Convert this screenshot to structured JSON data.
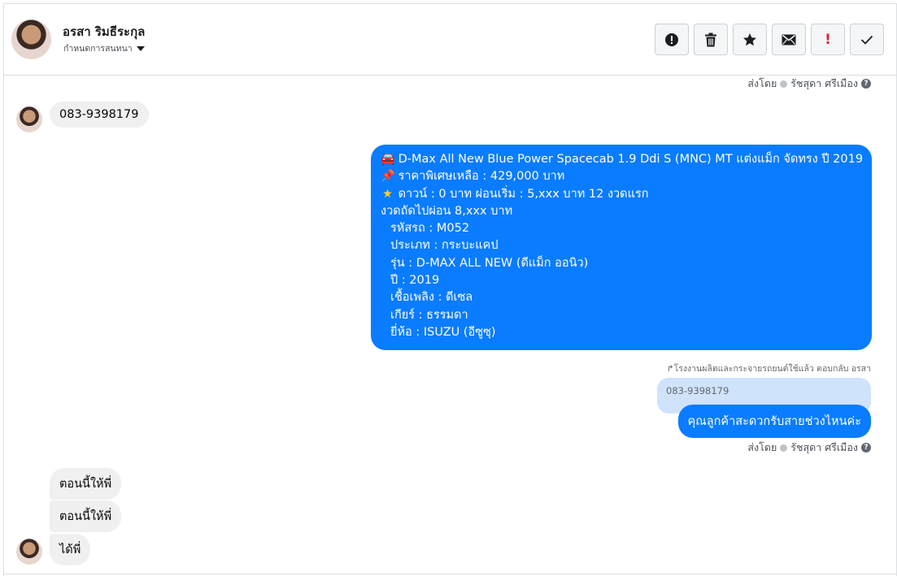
{
  "header": {
    "name": "อรสา ริมธีระกุล",
    "assign_label": "กำหนดการสนทนา",
    "toolbar": [
      {
        "id": "spam",
        "icon": "alert-circle-icon"
      },
      {
        "id": "delete",
        "icon": "trash-icon"
      },
      {
        "id": "star",
        "icon": "star-icon"
      },
      {
        "id": "mark-unread",
        "icon": "envelope-icon"
      },
      {
        "id": "important",
        "icon": "exclamation-icon",
        "label": "!"
      },
      {
        "id": "done",
        "icon": "check-icon"
      }
    ]
  },
  "sent_by_top": {
    "prefix": "ส่งโดย",
    "agent": "รัชสุดา ศรีเมือง",
    "help": "?"
  },
  "messages": {
    "in_phone": "083-9398179",
    "out_card": {
      "line1": "D-Max All New Blue Power Spacecab 1.9 Ddi S (MNC) MT แต่งแม็ก จัดทรง ปี 2019",
      "line2": "ราคาพิเศษเหลือ : 429,000 บาท",
      "line3": "ดาวน์ : 0 บาท ผ่อนเริ่ม : 5,xxx บาท 12 งวดแรก",
      "line4": "งวดถัดไปผ่อน  8,xxx บาท",
      "line5": "รหัสรถ : M052",
      "line6": "ประเภท : กระบะแคป",
      "line7": "รุ่น : D-MAX ALL NEW (ดีแม็ก ออนิว)",
      "line8": "ปี : 2019",
      "line9": "เชื้อเพลิง : ดีเซล",
      "line10": "เกียร์ : ธรรมดา",
      "line11": "ยี่ห้อ : ISUZU (อีซูซุ)"
    },
    "reply_header": "โรงงานผลิตและกระจายรถยนต์ใช้แล้ว ตอบกลับ อรสา",
    "quoted_text": "083-9398179",
    "out_reply": "คุณลูกค้าสะดวกรับสายช่วงไหนค่ะ",
    "in_msg_1": "ตอนนี้ให้พี่",
    "in_msg_2": "ตอนนี้ให้พี่",
    "in_msg_3": "ได้พี่"
  },
  "sent_by_bottom": {
    "prefix": "ส่งโดย",
    "agent": "รัชสุดา ศรีเมือง",
    "help": "?"
  },
  "colors": {
    "outgoing_bubble": "#0a7cff",
    "incoming_bubble": "#f0f0f0",
    "quoted_bubble": "#cfe3fb",
    "important": "#e41e3f"
  }
}
